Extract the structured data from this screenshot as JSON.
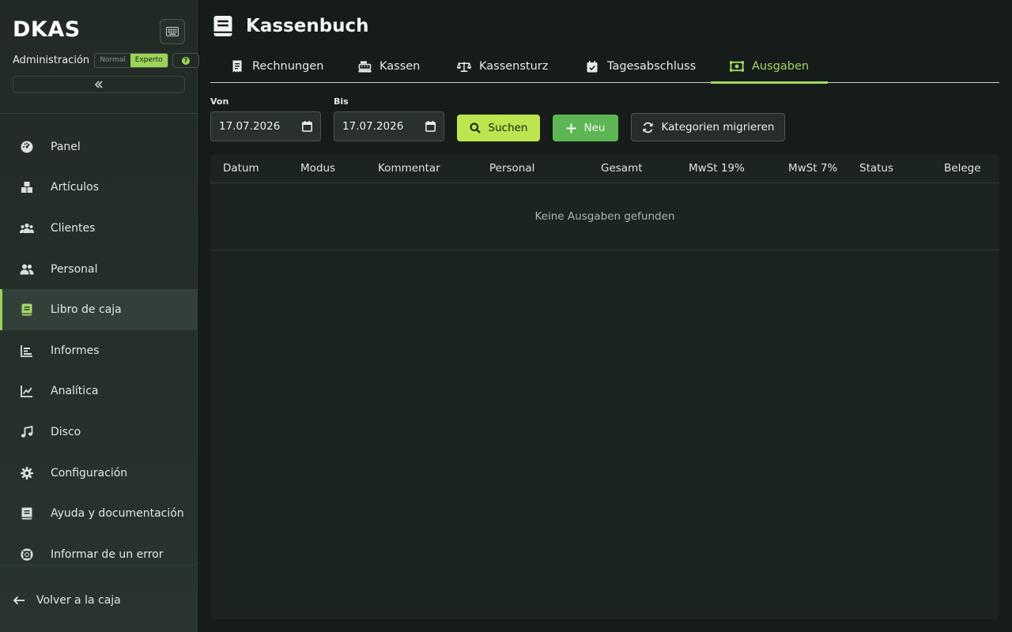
{
  "app": {
    "brand": "DKAS",
    "role_label": "Administración",
    "mode_options": [
      "Normal",
      "Experto"
    ],
    "active_mode": "Experto",
    "help_glyph": "?"
  },
  "sidebar": {
    "items": [
      {
        "label": "Panel",
        "icon": "dashboard-gauge-icon"
      },
      {
        "label": "Artículos",
        "icon": "boxes-icon"
      },
      {
        "label": "Clientes",
        "icon": "users-group-icon"
      },
      {
        "label": "Personal",
        "icon": "user-pair-icon"
      },
      {
        "label": "Libro de caja",
        "icon": "book-icon",
        "active": true
      },
      {
        "label": "Informes",
        "icon": "bar-chart-icon"
      },
      {
        "label": "Analítica",
        "icon": "line-chart-icon"
      },
      {
        "label": "Disco",
        "icon": "music-note-icon"
      },
      {
        "label": "Configuración",
        "icon": "gear-icon"
      },
      {
        "label": "Ayuda y documentación",
        "icon": "manual-icon"
      },
      {
        "label": "Informar de un error",
        "icon": "lifebuoy-icon"
      }
    ],
    "back_label": "Volver a la caja"
  },
  "header": {
    "title": "Kassenbuch"
  },
  "tabs": [
    {
      "label": "Rechnungen",
      "icon": "receipt-icon"
    },
    {
      "label": "Kassen",
      "icon": "cash-register-icon"
    },
    {
      "label": "Kassensturz",
      "icon": "scale-icon"
    },
    {
      "label": "Tagesabschluss",
      "icon": "calendar-check-icon"
    },
    {
      "label": "Ausgaben",
      "icon": "money-bill-icon",
      "active": true
    }
  ],
  "filters": {
    "from_label": "Von",
    "from_value": "17.07.2026",
    "to_label": "Bis",
    "to_value": "17.07.2026",
    "search_label": "Suchen",
    "new_label": "Neu",
    "migrate_label": "Kategorien migrieren"
  },
  "table": {
    "columns": [
      "Datum",
      "Modus",
      "Kommentar",
      "Personal",
      "Gesamt",
      "MwSt 19%",
      "MwSt 7%",
      "Status",
      "Belege"
    ],
    "empty_message": "Keine Ausgaben gefunden"
  },
  "colors": {
    "accent": "#a5d765",
    "search_button": "#bde54f",
    "new_button": "#5cb654",
    "background": "#161c19",
    "sidebar": "#26302a"
  }
}
